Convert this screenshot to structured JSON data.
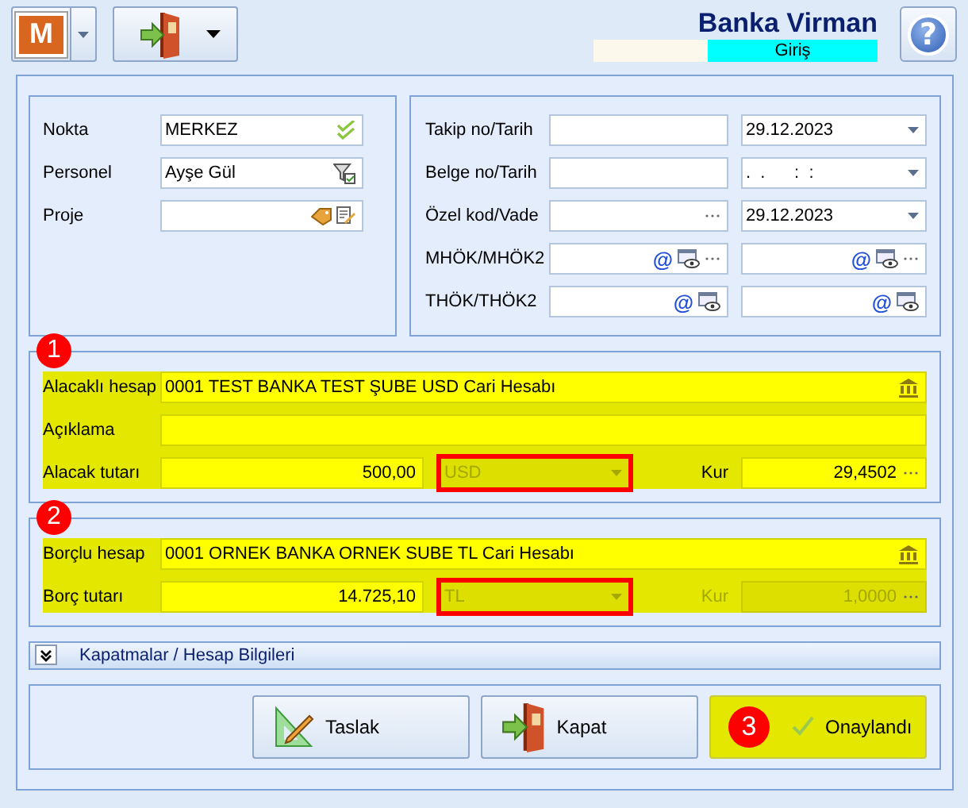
{
  "toolbar": {
    "logo_letter": "M",
    "title": "Banka Virman",
    "status": "Giriş",
    "help": "?"
  },
  "left_fields": [
    {
      "label": "Nokta",
      "value": "MERKEZ",
      "kind": "check"
    },
    {
      "label": "Personel",
      "value": "Ayşe Gül",
      "kind": "filter"
    },
    {
      "label": "Proje",
      "kind": "project"
    }
  ],
  "right_fields": [
    {
      "label": "Takip no/Tarih",
      "inputs": [
        {
          "kind": "text"
        },
        {
          "kind": "date",
          "value": "29.12.2023"
        }
      ]
    },
    {
      "label": "Belge no/Tarih",
      "inputs": [
        {
          "kind": "text"
        },
        {
          "kind": "date",
          "value": ".  .      :  :"
        }
      ]
    },
    {
      "label": "Özel kod/Vade",
      "inputs": [
        {
          "kind": "lookup"
        },
        {
          "kind": "date",
          "value": "29.12.2023"
        }
      ]
    },
    {
      "label": "MHÖK/MHÖK2",
      "inputs": [
        {
          "kind": "mail_lookup",
          "symbol": "@"
        },
        {
          "kind": "mail_lookup",
          "symbol": "@"
        }
      ]
    },
    {
      "label": "THÖK/THÖK2",
      "inputs": [
        {
          "kind": "mail",
          "symbol": "@"
        },
        {
          "kind": "mail",
          "symbol": "@"
        }
      ]
    }
  ],
  "sections": [
    {
      "badge": "1",
      "account_label": "Alacaklı hesap",
      "account": "0001 TEST BANKA TEST ŞUBE USD Cari Hesabı",
      "description_label": "Açıklama",
      "amount_label": "Alacak tutarı",
      "amount": "500,00",
      "currency": {
        "value": "USD",
        "disabled": true,
        "highlighted": true
      },
      "rate_label": "Kur",
      "rate": {
        "value": "29,4502",
        "disabled": false
      }
    },
    {
      "badge": "2",
      "account_label": "Borçlu hesap",
      "account": "0001 ORNEK BANKA ORNEK SUBE TL Cari Hesabı",
      "amount_label": "Borç tutarı",
      "amount": "14.725,10",
      "currency": {
        "value": "TL",
        "disabled": true,
        "highlighted": true
      },
      "rate_label": "Kur",
      "rate": {
        "value": "1,0000",
        "disabled": true
      }
    }
  ],
  "expander": {
    "label": "Kapatmalar / Hesap Bilgileri",
    "expanded": false
  },
  "buttons": [
    {
      "label": "Taslak",
      "kind": "draft",
      "selected": false
    },
    {
      "label": "Kapat",
      "kind": "close",
      "selected": false
    },
    {
      "label": "Onaylandı",
      "kind": "approved",
      "selected": true,
      "badge": "3"
    }
  ]
}
